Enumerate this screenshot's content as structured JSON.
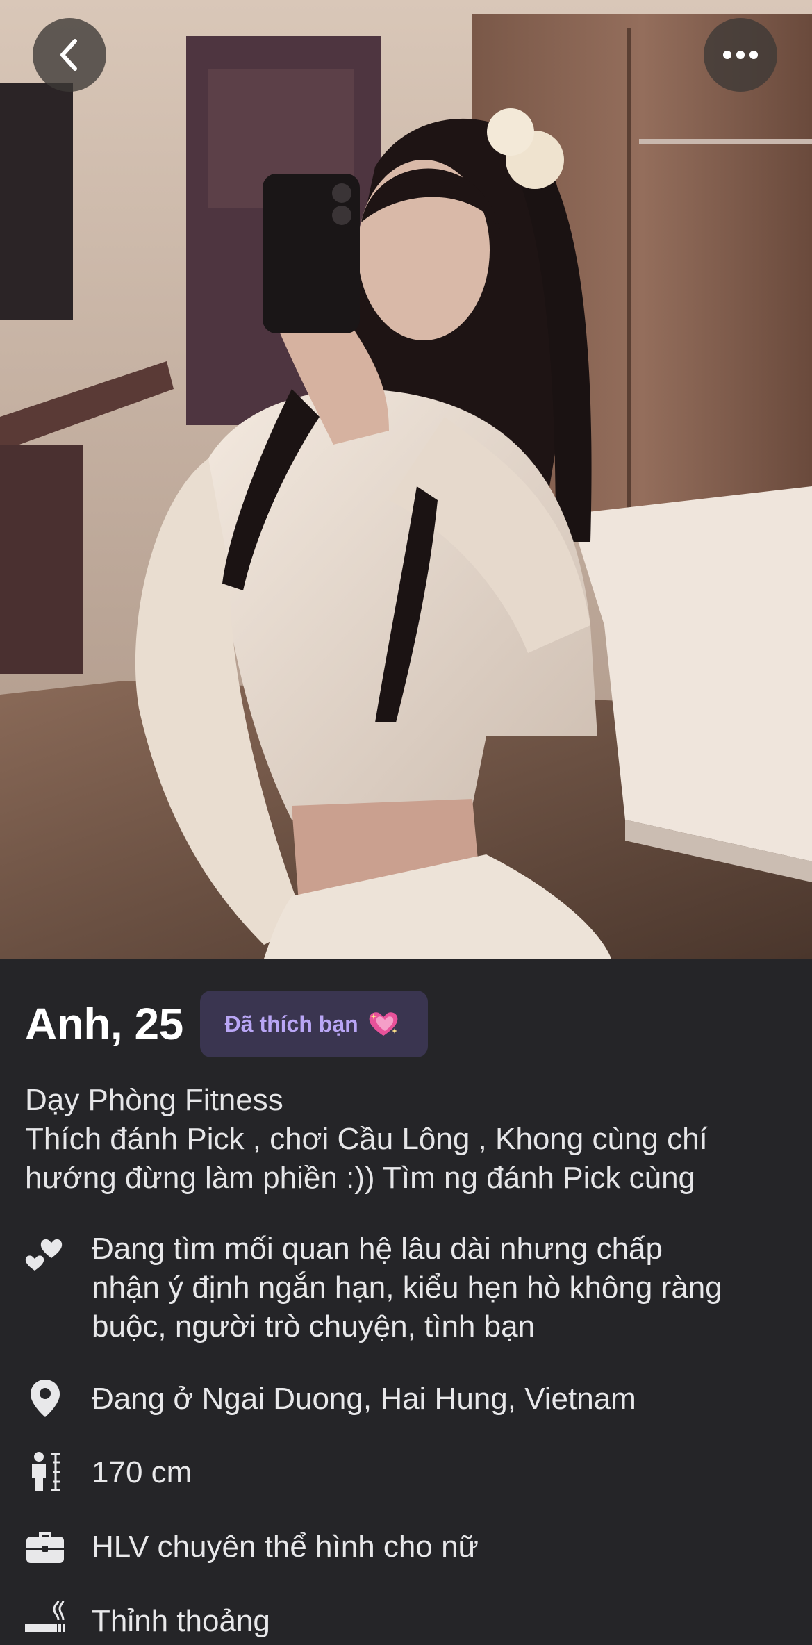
{
  "header": {
    "back_icon": "chevron-left-icon",
    "more_icon": "ellipsis-icon"
  },
  "profile": {
    "name_age": "Anh, 25",
    "liked_badge": "Đã thích bạn",
    "liked_badge_icon": "sparkling-heart-icon",
    "bio_lines": [
      "Dạy Phòng Fitness",
      "Thích đánh Pick , chơi Cầu Lông , Khong cùng chí",
      "hướng đừng làm phiền :)) Tìm ng đánh Pick cùng"
    ]
  },
  "details": {
    "relationship": {
      "icon": "hearts-icon",
      "lines": [
        "Đang tìm mối quan hệ lâu dài nhưng chấp",
        "nhận ý định ngắn hạn, kiểu hẹn hò không ràng",
        "buộc, người trò chuyện, tình bạn"
      ]
    },
    "location": {
      "icon": "location-pin-icon",
      "text": "Đang ở Ngai Duong, Hai Hung, Vietnam"
    },
    "height": {
      "icon": "height-icon",
      "text": "170 cm"
    },
    "job": {
      "icon": "briefcase-icon",
      "text": "HLV chuyên thể hình cho nữ"
    },
    "smoking": {
      "icon": "smoking-icon",
      "text": "Thỉnh thoảng"
    }
  },
  "colors": {
    "background": "#252528",
    "badge_bg": "#3a3550",
    "badge_text": "#b9a6f5"
  }
}
